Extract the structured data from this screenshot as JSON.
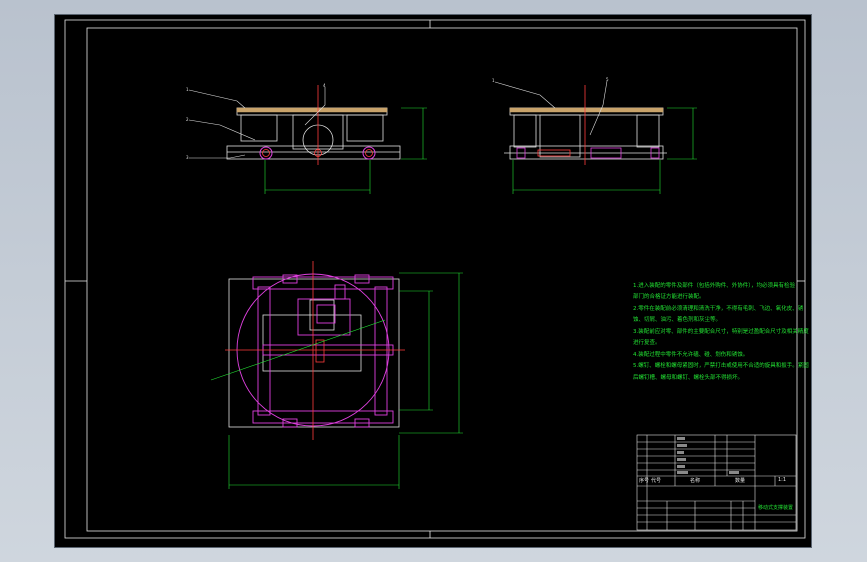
{
  "drawing": {
    "notes": [
      "1.进入装配的零件及部件（包括外购件、外协件），均必须具有检验",
      "部门的合格证方能进行装配。",
      "2.零件在装配前必须清理和清洗干净，不得有毛刺、飞边、氧化皮、锈",
      "蚀、切屑、油污、着色剂和灰尘等。",
      "3.装配前应对零、部件的主要配合尺寸，特别是过盈配合尺寸及相关精度",
      "进行复查。",
      "4.装配过程中零件不允许磕、碰、划伤和锈蚀。",
      "5.螺钉、螺栓和螺母紧固时，严禁打击或使用不合适的旋具和扳手。紧固",
      "后螺钉槽、螺母和螺钉、螺栓头部不得损坏。"
    ],
    "title_block": {
      "header_seq": "序号",
      "header_code": "代号",
      "header_name": "名称",
      "header_qty": "数量",
      "drawing_name": "移动式支撑装置",
      "scale": "1:1"
    },
    "part_labels": [
      "1",
      "2",
      "3",
      "4",
      "5"
    ]
  }
}
